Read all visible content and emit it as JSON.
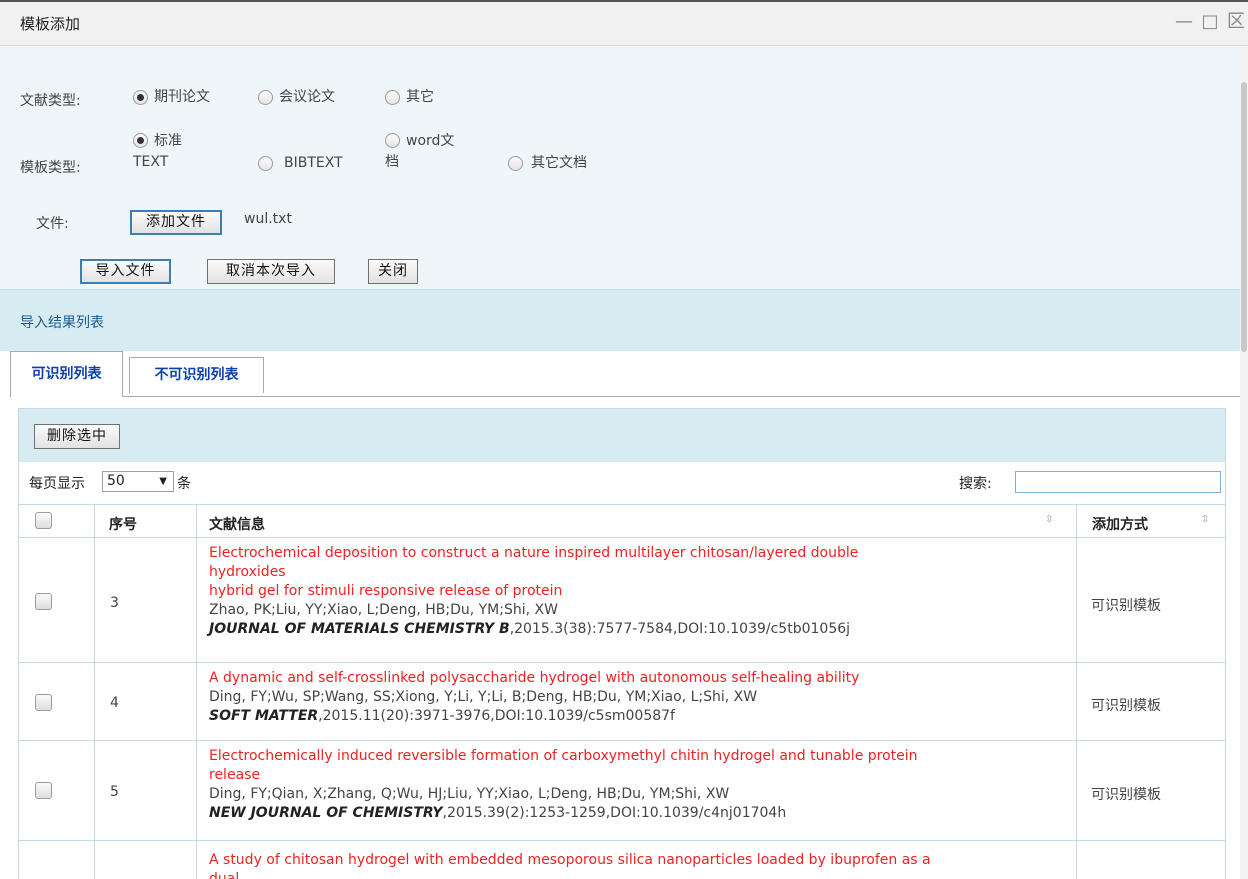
{
  "window": {
    "title": "模板添加",
    "controls": [
      "—",
      "□",
      "区"
    ]
  },
  "form": {
    "doc_type_label": "文献类型:",
    "doc_type_options": [
      {
        "label": "期刊论文",
        "checked": true
      },
      {
        "label": "会议论文",
        "checked": false
      },
      {
        "label": "其它",
        "checked": false
      }
    ],
    "template_type_label": "模板类型:",
    "template_type_options": [
      {
        "label_line1": "标准",
        "label_line2": "TEXT",
        "checked": true
      },
      {
        "label": "BIBTEXT",
        "checked": false
      },
      {
        "label_line1": "word文",
        "label_line2": "档",
        "checked": false
      },
      {
        "label": "其它文档",
        "checked": false
      }
    ],
    "file_label": "文件:",
    "add_file_button": "添加文件",
    "file_name": "wul.txt",
    "import_button": "导入文件",
    "cancel_import_button": "取消本次导入",
    "close_button": "关闭"
  },
  "results": {
    "section_title": "导入结果列表",
    "tabs": [
      {
        "label": "可识别列表",
        "active": true
      },
      {
        "label": "不可识别列表",
        "active": false
      }
    ],
    "delete_selected_button": "删除选中",
    "per_page_label": "每页显示",
    "per_page_value": "50",
    "per_page_suffix": "条",
    "search_label": "搜索:",
    "search_value": "",
    "columns": {
      "index": "序号",
      "info": "文献信息",
      "method": "添加方式"
    },
    "rows": [
      {
        "index": "3",
        "title_lines": [
          "Electrochemical deposition to construct a nature inspired multilayer chitosan/layered double",
          "hydroxides",
          "hybrid gel for stimuli responsive release of protein"
        ],
        "authors": "Zhao, PK;Liu, YY;Xiao, L;Deng, HB;Du, YM;Shi, XW",
        "journal": "JOURNAL OF MATERIALS CHEMISTRY B",
        "citation": ",2015.3(38):7577-7584,DOI:10.1039/c5tb01056j",
        "method": "可识别模板"
      },
      {
        "index": "4",
        "title_lines": [
          "A dynamic and self-crosslinked polysaccharide hydrogel with autonomous self-healing ability"
        ],
        "authors": "Ding, FY;Wu, SP;Wang, SS;Xiong, Y;Li, Y;Li, B;Deng, HB;Du, YM;Xiao, L;Shi, XW",
        "journal": "SOFT MATTER",
        "citation": ",2015.11(20):3971-3976,DOI:10.1039/c5sm00587f",
        "method": "可识别模板"
      },
      {
        "index": "5",
        "title_lines": [
          "Electrochemically induced reversible formation of carboxymethyl chitin hydrogel and tunable protein",
          "release"
        ],
        "authors": "Ding, FY;Qian, X;Zhang, Q;Wu, HJ;Liu, YY;Xiao, L;Deng, HB;Du, YM;Shi, XW",
        "journal": "NEW JOURNAL OF CHEMISTRY",
        "citation": ",2015.39(2):1253-1259,DOI:10.1039/c4nj01704h",
        "method": "可识别模板"
      },
      {
        "index": "",
        "title_lines": [
          "A study of chitosan hydrogel with embedded mesoporous silica nanoparticles loaded by ibuprofen as a",
          "dual"
        ],
        "authors": "",
        "journal": "",
        "citation": "",
        "method": ""
      }
    ]
  },
  "colors": {
    "title_red": "#ee2222",
    "tab_blue": "#0a3fb0",
    "panel_bg": "#eef6fa",
    "bar_bg": "#d7ebf3"
  }
}
